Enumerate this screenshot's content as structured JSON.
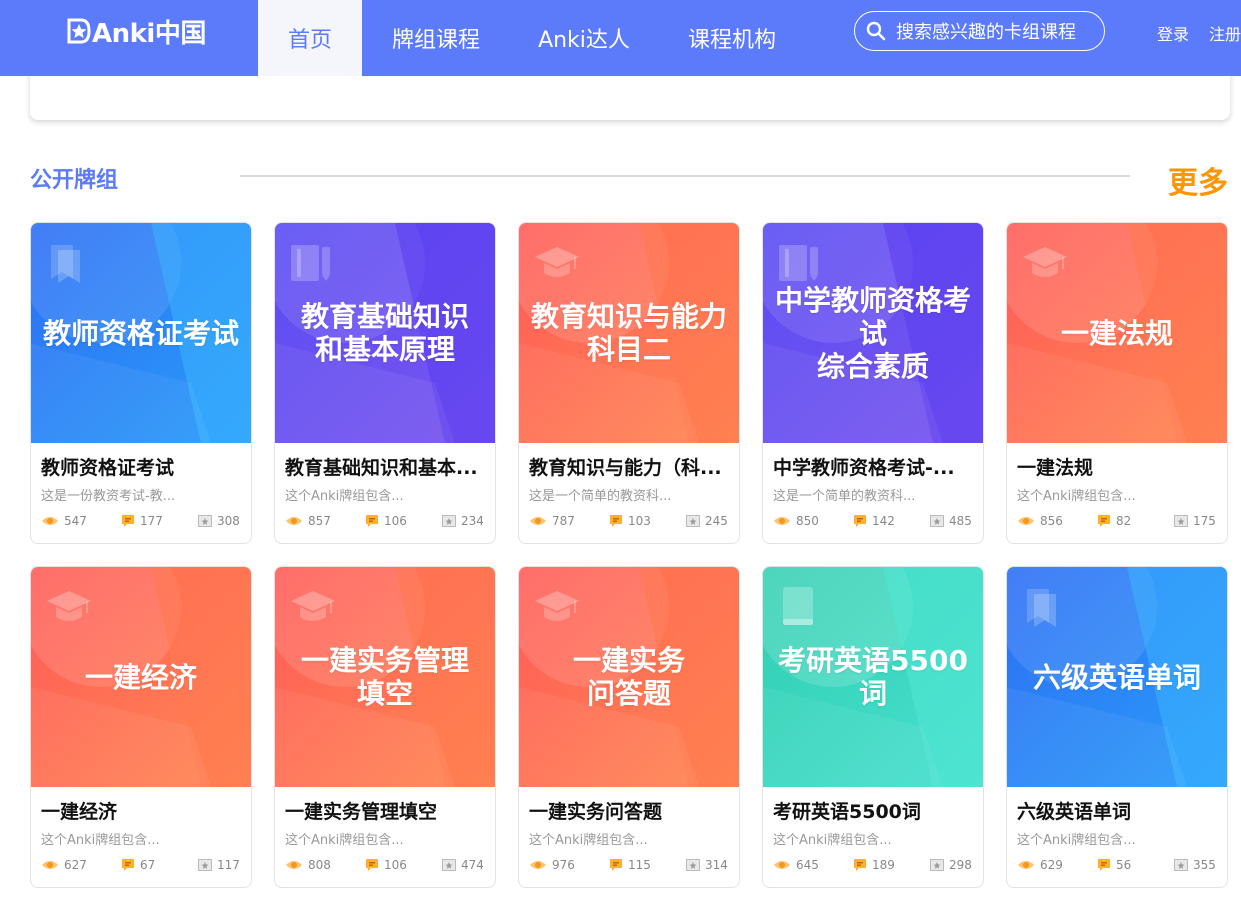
{
  "header": {
    "logo_text": "Anki中国",
    "nav": [
      {
        "label": "首页",
        "active": true
      },
      {
        "label": "牌组课程",
        "active": false
      },
      {
        "label": "Anki达人",
        "active": false
      },
      {
        "label": "课程机构",
        "active": false
      }
    ],
    "search_placeholder": "搜索感兴趣的卡组课程",
    "login_label": "登录",
    "register_label": "注册"
  },
  "section": {
    "title": "公开牌组",
    "more_label": "更多"
  },
  "colors": {
    "brand": "#5b7bfa",
    "more": "#ff9500",
    "blue_cover": "#2e7cf6",
    "purple_cover": "#6c4ef2",
    "orange_cover": "#ff6a5a",
    "teal_cover": "#3ed9c0"
  },
  "cards": [
    {
      "cover_title": "教师资格证考试",
      "title": "教师资格证考试",
      "desc": "这是一份教资考试-教...",
      "views": "547",
      "comments": "177",
      "cards": "308",
      "theme": "blue",
      "icon": "bookmark-icon"
    },
    {
      "cover_title": "教育基础知识\n和基本原理",
      "title": "教育基础知识和基本...",
      "desc": "这个Anki牌组包含...",
      "views": "857",
      "comments": "106",
      "cards": "234",
      "theme": "purple",
      "icon": "notebook-icon"
    },
    {
      "cover_title": "教育知识与能力\n科目二",
      "title": "教育知识与能力（科...",
      "desc": "这是一个简单的教资科...",
      "views": "787",
      "comments": "103",
      "cards": "245",
      "theme": "orange",
      "icon": "graduation-cap-icon"
    },
    {
      "cover_title": "中学教师资格考试\n综合素质",
      "title": "中学教师资格考试-...",
      "desc": "这是一个简单的教资科...",
      "views": "850",
      "comments": "142",
      "cards": "485",
      "theme": "purple",
      "icon": "notebook-icon"
    },
    {
      "cover_title": "一建法规",
      "title": "一建法规",
      "desc": "这个Anki牌组包含...",
      "views": "856",
      "comments": "82",
      "cards": "175",
      "theme": "orange",
      "icon": "graduation-cap-icon"
    },
    {
      "cover_title": "一建经济",
      "title": "一建经济",
      "desc": "这个Anki牌组包含...",
      "views": "627",
      "comments": "67",
      "cards": "117",
      "theme": "orange",
      "icon": "graduation-cap-icon"
    },
    {
      "cover_title": "一建实务管理\n填空",
      "title": "一建实务管理填空",
      "desc": "这个Anki牌组包含...",
      "views": "808",
      "comments": "106",
      "cards": "474",
      "theme": "orange",
      "icon": "graduation-cap-icon"
    },
    {
      "cover_title": "一建实务\n问答题",
      "title": "一建实务问答题",
      "desc": "这个Anki牌组包含...",
      "views": "976",
      "comments": "115",
      "cards": "314",
      "theme": "orange",
      "icon": "graduation-cap-icon"
    },
    {
      "cover_title": "考研英语5500词",
      "title": "考研英语5500词",
      "desc": "这个Anki牌组包含...",
      "views": "645",
      "comments": "189",
      "cards": "298",
      "theme": "teal",
      "icon": "book-icon"
    },
    {
      "cover_title": "六级英语单词",
      "title": "六级英语单词",
      "desc": "这个Anki牌组包含...",
      "views": "629",
      "comments": "56",
      "cards": "355",
      "theme": "blue",
      "icon": "bookmark-icon"
    }
  ]
}
